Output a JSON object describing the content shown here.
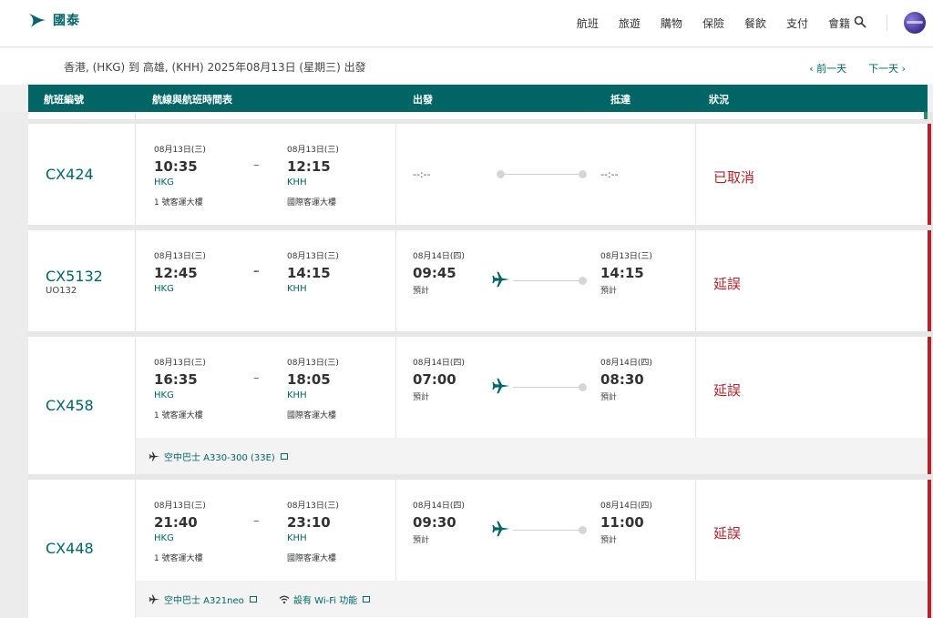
{
  "brand": {
    "name": "國泰"
  },
  "nav": [
    "航班",
    "旅遊",
    "購物",
    "保險",
    "餐飲",
    "支付",
    "會籍"
  ],
  "subheader": {
    "title": "香港, (HKG) 到 高雄, (KHH) 2025年08月13日 (星期三) 出發",
    "prev_day": "‹  前一天",
    "next_day": "下一天  ›"
  },
  "columns": {
    "flight": "航班編號",
    "route": "航線與航班時間表",
    "depart": "出發",
    "arrive": "抵達",
    "status": "狀況"
  },
  "flights": [
    {
      "flight": "CX424",
      "codeshare": "",
      "dep_date": "08月13日(三)",
      "dep_time": "10:35",
      "dep_code": "HKG",
      "dep_term": "1 號客運大樓",
      "arr_date": "08月13日(三)",
      "arr_time": "12:15",
      "arr_code": "KHH",
      "arr_term": "國際客運大樓",
      "act_dep": "--:--",
      "act_arr": "--:--",
      "status": "已取消"
    },
    {
      "flight": "CX5132",
      "codeshare": "UO132",
      "dep_date": "08月13日(三)",
      "dep_time": "12:45",
      "dep_code": "HKG",
      "arr_date": "08月13日(三)",
      "arr_time": "14:15",
      "arr_code": "KHH",
      "act_dep_date": "08月14日(四)",
      "act_dep_time": "09:45",
      "act_dep_note": "預計",
      "act_arr_date": "08月13日(三)",
      "act_arr_time": "14:15",
      "act_arr_note": "預計",
      "status": "延誤"
    },
    {
      "flight": "CX458",
      "codeshare": "",
      "dep_date": "08月13日(三)",
      "dep_time": "16:35",
      "dep_code": "HKG",
      "dep_term": "1 號客運大樓",
      "arr_date": "08月13日(三)",
      "arr_time": "18:05",
      "arr_code": "KHH",
      "arr_term": "國際客運大樓",
      "act_dep_date": "08月14日(四)",
      "act_dep_time": "07:00",
      "act_dep_note": "預計",
      "act_arr_date": "08月14日(四)",
      "act_arr_time": "08:30",
      "act_arr_note": "預計",
      "status": "延誤",
      "aircraft": "空中巴士 A330-300 (33E)"
    },
    {
      "flight": "CX448",
      "codeshare": "",
      "dep_date": "08月13日(三)",
      "dep_time": "21:40",
      "dep_code": "HKG",
      "dep_term": "1 號客運大樓",
      "arr_date": "08月13日(三)",
      "arr_time": "23:10",
      "arr_code": "KHH",
      "arr_term": "國際客運大樓",
      "act_dep_date": "08月14日(四)",
      "act_dep_time": "09:30",
      "act_dep_note": "預計",
      "act_arr_date": "08月14日(四)",
      "act_arr_time": "11:00",
      "act_arr_note": "預計",
      "status": "延誤",
      "aircraft": "空中巴士 A321neo",
      "wifi": "設有 Wi-Fi 功能"
    }
  ],
  "colors": {
    "brand": "#006564",
    "alert": "#b0242d"
  }
}
